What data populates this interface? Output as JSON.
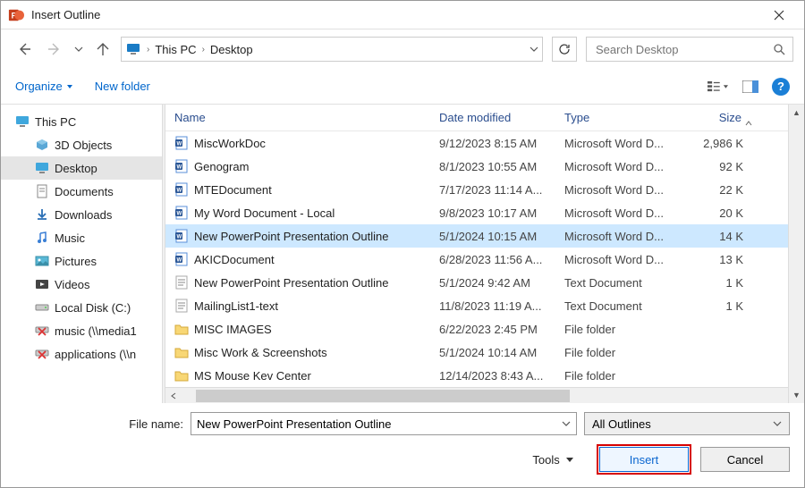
{
  "title": "Insert Outline",
  "breadcrumb": {
    "seg1": "This PC",
    "seg2": "Desktop"
  },
  "search": {
    "placeholder": "Search Desktop"
  },
  "toolbar": {
    "organize": "Organize",
    "newfolder": "New folder"
  },
  "sidebar": {
    "root": "This PC",
    "items": [
      {
        "label": "3D Objects"
      },
      {
        "label": "Desktop"
      },
      {
        "label": "Documents"
      },
      {
        "label": "Downloads"
      },
      {
        "label": "Music"
      },
      {
        "label": "Pictures"
      },
      {
        "label": "Videos"
      },
      {
        "label": "Local Disk (C:)"
      },
      {
        "label": "music (\\\\media1"
      },
      {
        "label": "applications (\\\\n"
      }
    ]
  },
  "headers": {
    "name": "Name",
    "date": "Date modified",
    "type": "Type",
    "size": "Size"
  },
  "files": [
    {
      "icon": "word",
      "name": "MiscWorkDoc",
      "date": "9/12/2023 8:15 AM",
      "type": "Microsoft Word D...",
      "size": "2,986 K"
    },
    {
      "icon": "word",
      "name": "Genogram",
      "date": "8/1/2023 10:55 AM",
      "type": "Microsoft Word D...",
      "size": "92 K"
    },
    {
      "icon": "word",
      "name": "MTEDocument",
      "date": "7/17/2023 11:14 A...",
      "type": "Microsoft Word D...",
      "size": "22 K"
    },
    {
      "icon": "word",
      "name": "My Word Document - Local",
      "date": "9/8/2023 10:17 AM",
      "type": "Microsoft Word D...",
      "size": "20 K"
    },
    {
      "icon": "word",
      "name": "New PowerPoint Presentation Outline",
      "date": "5/1/2024 10:15 AM",
      "type": "Microsoft Word D...",
      "size": "14 K",
      "selected": true
    },
    {
      "icon": "word",
      "name": "AKICDocument",
      "date": "6/28/2023 11:56 A...",
      "type": "Microsoft Word D...",
      "size": "13 K"
    },
    {
      "icon": "text",
      "name": "New PowerPoint Presentation Outline",
      "date": "5/1/2024 9:42 AM",
      "type": "Text Document",
      "size": "1 K"
    },
    {
      "icon": "text",
      "name": "MailingList1-text",
      "date": "11/8/2023 11:19 A...",
      "type": "Text Document",
      "size": "1 K"
    },
    {
      "icon": "folder",
      "name": "MISC IMAGES",
      "date": "6/22/2023 2:45 PM",
      "type": "File folder",
      "size": ""
    },
    {
      "icon": "folder",
      "name": "Misc Work & Screenshots",
      "date": "5/1/2024 10:14 AM",
      "type": "File folder",
      "size": ""
    },
    {
      "icon": "folder",
      "name": "MS Mouse Kev Center",
      "date": "12/14/2023 8:43 A...",
      "type": "File folder",
      "size": ""
    }
  ],
  "filename": {
    "label": "File name:",
    "value": "New PowerPoint Presentation Outline"
  },
  "filter": {
    "label": "All Outlines"
  },
  "buttons": {
    "tools": "Tools",
    "insert": "Insert",
    "cancel": "Cancel"
  }
}
